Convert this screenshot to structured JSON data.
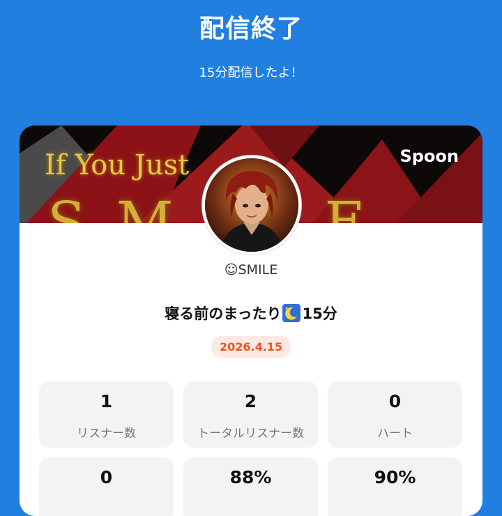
{
  "header": {
    "title": "配信終了",
    "subtitle": "15分配信したよ！"
  },
  "card": {
    "brand": "Spoon",
    "banner_text": "If You Just",
    "banner_big": "SMILE",
    "username": "☺SMILE",
    "live_title_before": "寝る前のまったり",
    "live_title_after": "15分",
    "date": "2026.4.15"
  },
  "stats": [
    {
      "value": "1",
      "label": "リスナー数"
    },
    {
      "value": "2",
      "label": "トータルリスナー数"
    },
    {
      "value": "0",
      "label": "ハート"
    },
    {
      "value": "0",
      "label": ""
    },
    {
      "value": "88%",
      "label": ""
    },
    {
      "value": "90%",
      "label": ""
    }
  ],
  "colors": {
    "background": "#217fe0",
    "date_badge_text": "#f0561f",
    "date_badge_bg": "#fde9e4",
    "moon_emoji_bg": "#2f6fd6"
  },
  "icons": {
    "moon": "crescent-moon-icon"
  }
}
